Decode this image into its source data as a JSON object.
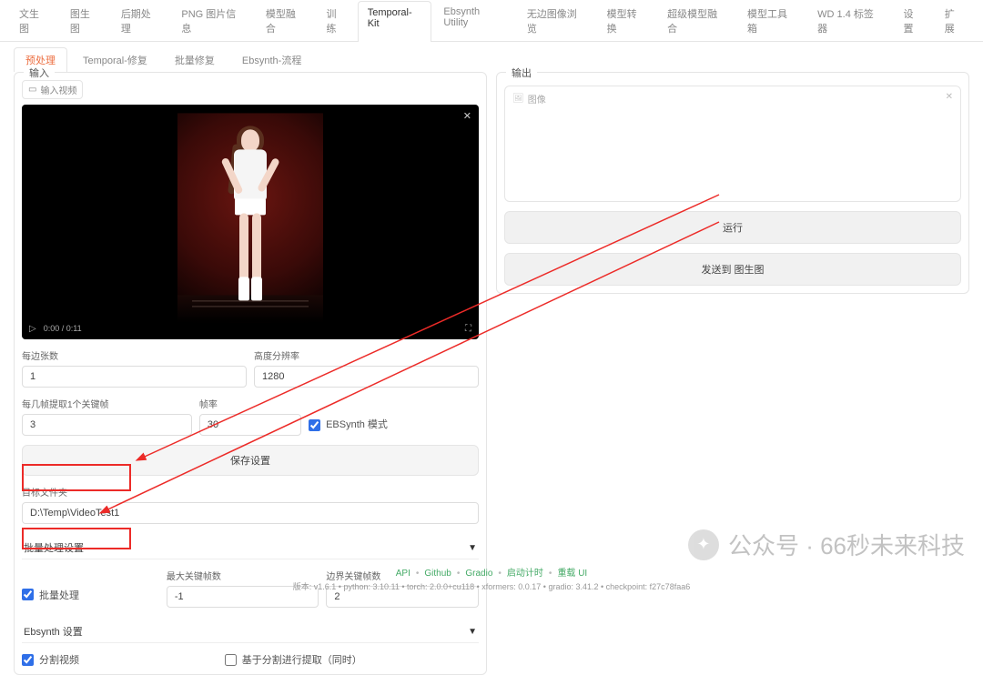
{
  "main_tabs": [
    "文生图",
    "图生图",
    "后期处理",
    "PNG 图片信息",
    "模型融合",
    "训练",
    "Temporal-Kit",
    "Ebsynth Utility",
    "无边图像浏览",
    "模型转换",
    "超级模型融合",
    "模型工具箱",
    "WD 1.4 标签器",
    "设置",
    "扩展"
  ],
  "main_active": 6,
  "sub_tabs": [
    "预处理",
    "Temporal-修复",
    "批量修复",
    "Ebsynth-流程"
  ],
  "sub_active": 0,
  "left": {
    "title": "输入",
    "video_badge": "输入视频",
    "time": "0:00 / 0:11",
    "per_side": {
      "label": "每边张数",
      "value": "1"
    },
    "height": {
      "label": "高度分辨率",
      "value": "1280"
    },
    "keyframe": {
      "label": "每几帧提取1个关键帧",
      "value": "3"
    },
    "fps": {
      "label": "帧率",
      "value": "30"
    },
    "ebsynth_mode": "EBSynth 模式",
    "save_settings": "保存设置",
    "target_folder": {
      "label": "目标文件夹",
      "value": "D:\\Temp\\VideoTest1"
    },
    "batch_header": "批量处理设置",
    "batch_chk": "批量处理",
    "max_kf": {
      "label": "最大关键帧数",
      "value": "-1"
    },
    "border_kf": {
      "label": "边界关键帧数",
      "value": "2"
    },
    "ebsynth_header": "Ebsynth 设置",
    "split_video": "分割视频",
    "split_based": "基于分割进行提取（同时）"
  },
  "right": {
    "title": "输出",
    "img_badge": "图像",
    "run": "运行",
    "send": "发送到 图生图"
  },
  "watermark": "公众号 · 66秒未来科技",
  "footer_links": [
    "API",
    "Github",
    "Gradio",
    "启动计时",
    "重载 UI"
  ],
  "footer_meta": "版本: v1.6.1  •  python: 3.10.11  •  torch: 2.0.0+cu118  •  xformers: 0.0.17  •  gradio: 3.41.2  •  checkpoint: f27c78faa6"
}
